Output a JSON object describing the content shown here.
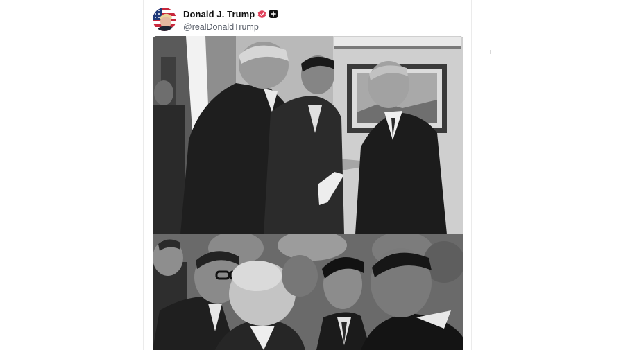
{
  "post": {
    "author": {
      "display_name": "Donald J. Trump",
      "handle": "@realDonaldTrump",
      "avatar_icon": "avatar-flag-portrait",
      "verified_icon": "verified-badge-icon",
      "plus_icon": "plus-badge-icon"
    },
    "media": {
      "images": [
        {
          "description_icon": "photo-meeting-modern"
        },
        {
          "description_icon": "photo-meeting-historic"
        }
      ]
    }
  },
  "colors": {
    "badge": "#e0405a",
    "text_primary": "#111111",
    "text_secondary": "#555b66",
    "border": "#ebebeb"
  }
}
